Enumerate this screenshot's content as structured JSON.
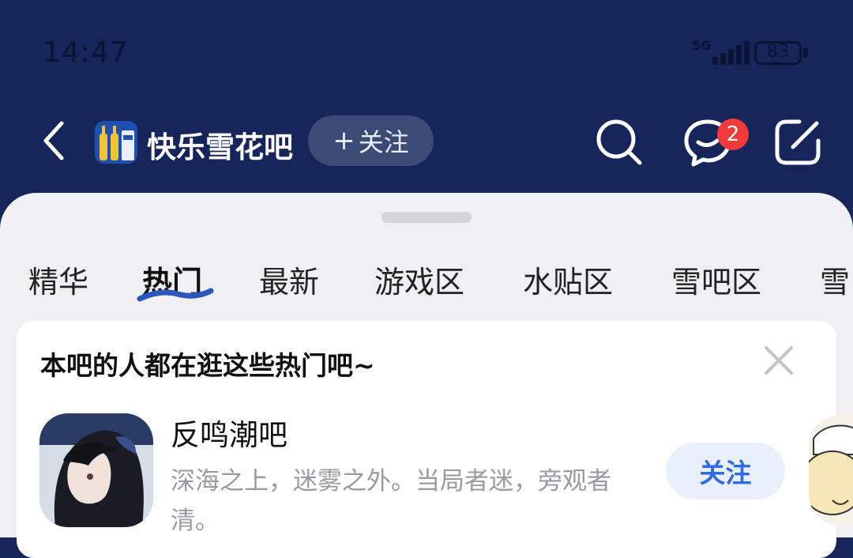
{
  "status": {
    "time": "14:47",
    "network": "5G",
    "battery": "83"
  },
  "header": {
    "forum_name": "快乐雪花吧",
    "follow_label": "关注",
    "message_badge": "2"
  },
  "tabs": [
    {
      "label": "精华"
    },
    {
      "label": "热门",
      "active": true
    },
    {
      "label": "最新"
    },
    {
      "label": "游戏区"
    },
    {
      "label": "水贴区"
    },
    {
      "label": "雪吧区"
    },
    {
      "label": "雪"
    }
  ],
  "recommend": {
    "title": "本吧的人都在逛这些热门吧~",
    "items": [
      {
        "name": "反鸣潮吧",
        "desc": "深海之上，迷雾之外。当局者迷，旁观者清。",
        "follow_label": "关注"
      }
    ]
  },
  "colors": {
    "header_bg": "#16265a",
    "accent": "#2f6be6",
    "badge": "#f23a3a"
  }
}
